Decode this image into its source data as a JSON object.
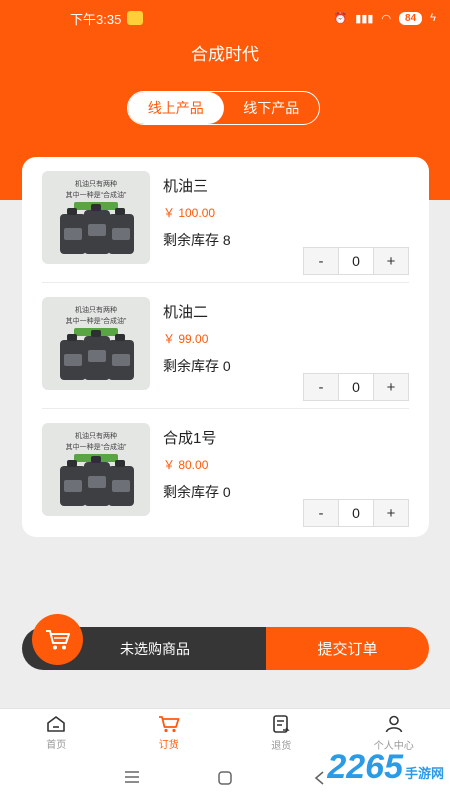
{
  "status": {
    "time": "下午3:35",
    "battery": "84"
  },
  "app": {
    "title": "合成时代"
  },
  "tabs_segment": [
    {
      "label": "线上产品",
      "active": true
    },
    {
      "label": "线下产品",
      "active": false
    }
  ],
  "product_image": {
    "line1": "机油只有两种",
    "line2": "其中一种是“合成油”"
  },
  "products": [
    {
      "name": "机油三",
      "price": "￥ 100.00",
      "stock": "剩余库存 8",
      "quantity": "0"
    },
    {
      "name": "机油二",
      "price": "￥ 99.00",
      "stock": "剩余库存 0",
      "quantity": "0"
    },
    {
      "name": "合成1号",
      "price": "￥ 80.00",
      "stock": "剩余库存 0",
      "quantity": "0"
    }
  ],
  "stepper": {
    "minus": "-",
    "plus": "+"
  },
  "cart": {
    "empty_label": "未选购商品",
    "submit_label": "提交订单"
  },
  "bottom_tabs": [
    {
      "label": "首页",
      "icon": "home-icon",
      "active": false
    },
    {
      "label": "订货",
      "icon": "cart-icon",
      "active": true
    },
    {
      "label": "退货",
      "icon": "return-icon",
      "active": false
    },
    {
      "label": "个人中心",
      "icon": "user-icon",
      "active": false
    }
  ],
  "watermark": {
    "number": "2265",
    "text": "手游网"
  },
  "colors": {
    "accent": "#ff5a0a",
    "dark": "#363636",
    "background": "#ededed"
  }
}
